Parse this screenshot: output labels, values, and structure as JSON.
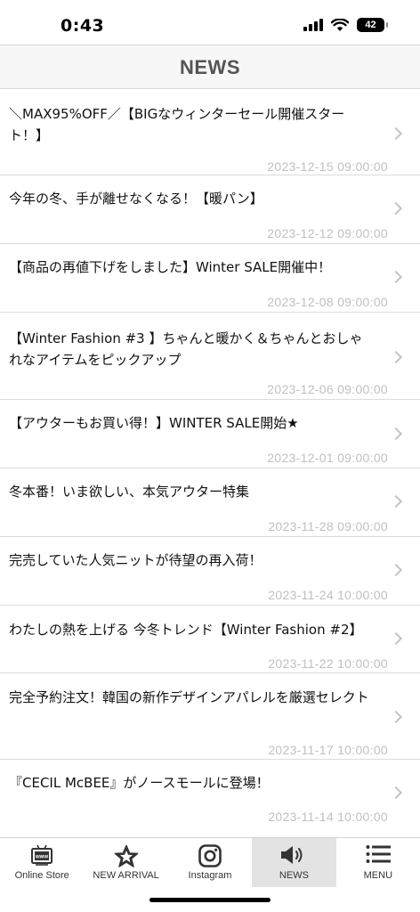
{
  "status_bar": {
    "time": "0:43",
    "battery": "42"
  },
  "header": {
    "title": "NEWS"
  },
  "news": [
    {
      "title": "＼MAX95%OFF／【BIGなウィンターセール開催スタート！】",
      "date": "2023-12-15 09:00:00"
    },
    {
      "title": "今年の冬、手が離せなくなる！【暖パン】",
      "date": "2023-12-12 09:00:00"
    },
    {
      "title": "【商品の再値下げをしました】Winter SALE開催中！",
      "date": "2023-12-08 09:00:00"
    },
    {
      "title": "【Winter Fashion #3 】ちゃんと暖かく＆ちゃんとおしゃれなアイテムをピックアップ",
      "date": "2023-12-06 09:00:00"
    },
    {
      "title": "【アウターもお買い得！】WINTER SALE開始★",
      "date": "2023-12-01 09:00:00"
    },
    {
      "title": "冬本番！いま欲しい、本気アウター特集",
      "date": "2023-11-28 09:00:00"
    },
    {
      "title": "完売していた人気ニットが待望の再入荷！",
      "date": "2023-11-24 10:00:00"
    },
    {
      "title": "わたしの熱を上げる 今冬トレンド【Winter Fashion #2】",
      "date": "2023-11-22 10:00:00"
    },
    {
      "title": "完全予約注文！韓国の新作デザインアパレルを厳選セレクト",
      "date": "2023-11-17 10:00:00"
    },
    {
      "title": "『CECIL McBEE』がノースモールに登場！",
      "date": "2023-11-14 10:00:00"
    }
  ],
  "tabs": [
    {
      "label": "Online Store",
      "icon": "online-store-icon"
    },
    {
      "label": "NEW ARRIVAL",
      "icon": "star-icon"
    },
    {
      "label": "Instagram",
      "icon": "instagram-icon"
    },
    {
      "label": "NEWS",
      "icon": "megaphone-icon",
      "active": true
    },
    {
      "label": "MENU",
      "icon": "hamburger-menu-icon"
    }
  ]
}
